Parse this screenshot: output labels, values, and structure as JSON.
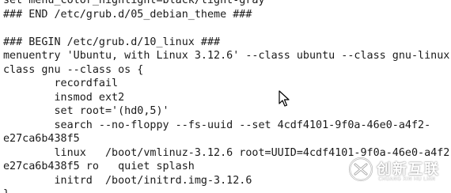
{
  "editor": {
    "lines": [
      "set menu_color_highlight=black/light-gray",
      "### END /etc/grub.d/05_debian_theme ###",
      "",
      "### BEGIN /etc/grub.d/10_linux ###",
      "menuentry 'Ubuntu, with Linux 3.12.6' --class ubuntu --class gnu-linux",
      "class gnu --class os {",
      "        recordfail",
      "        insmod ext2",
      "        set root='(hd0,5)'",
      "        search --no-floppy --fs-uuid --set 4cdf4101-9f0a-46e0-a4f2-",
      "e27ca6b438f5",
      "        linux   /boot/vmlinuz-3.12.6 root=UUID=4cdf4101-9f0a-46e0-a4f2-",
      "e27ca6b438f5 ro   quiet splash",
      "        initrd  /boot/initrd.img-3.12.6",
      "}"
    ]
  },
  "watermark": {
    "brand_cn": "创新互联",
    "brand_en": "CHUANG XIN HU LIAN",
    "logo_icon": "x-swirl-logo-icon"
  },
  "pointer": {
    "icon": "mouse-pointer-icon"
  }
}
